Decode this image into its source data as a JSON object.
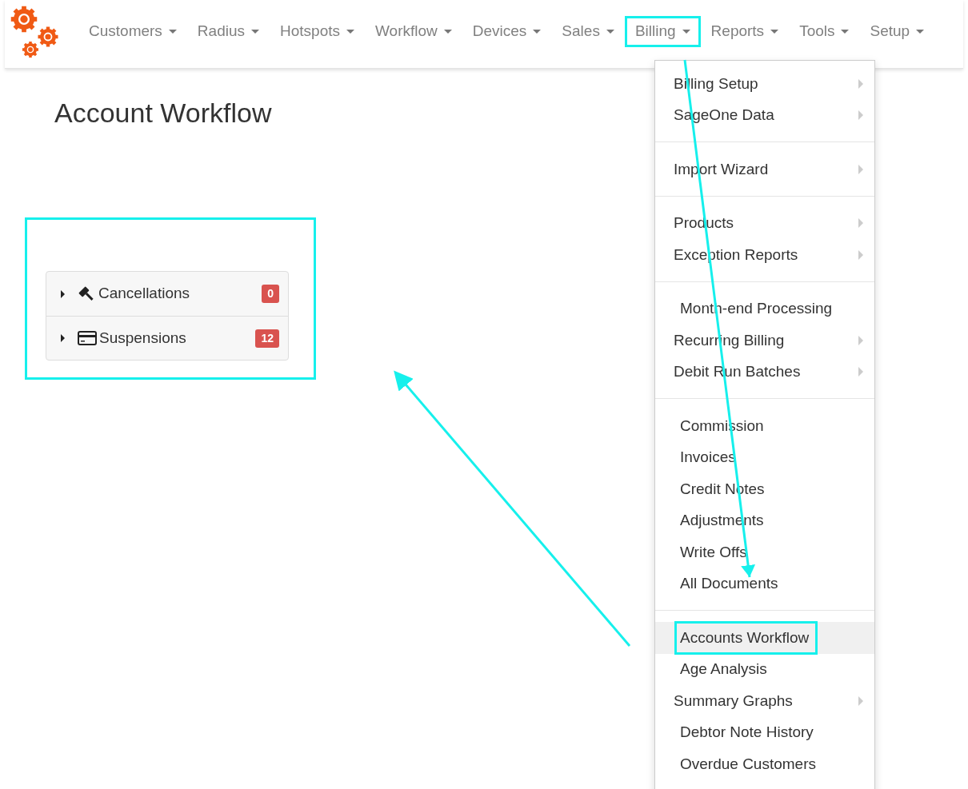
{
  "navbar": {
    "items": [
      {
        "label": "Customers",
        "selected": false
      },
      {
        "label": "Radius",
        "selected": false
      },
      {
        "label": "Hotspots",
        "selected": false
      },
      {
        "label": "Workflow",
        "selected": false
      },
      {
        "label": "Devices",
        "selected": false
      },
      {
        "label": "Sales",
        "selected": false
      },
      {
        "label": "Billing",
        "selected": true
      },
      {
        "label": "Reports",
        "selected": false
      },
      {
        "label": "Tools",
        "selected": false
      },
      {
        "label": "Setup",
        "selected": false
      }
    ]
  },
  "page": {
    "title": "Account Workflow"
  },
  "workflow_panel": {
    "rows": [
      {
        "label": "Cancellations",
        "kind": "gavel",
        "count": "0"
      },
      {
        "label": "Suspensions",
        "kind": "card",
        "count": "12"
      }
    ]
  },
  "billing_menu": {
    "groups": [
      [
        {
          "label": "Billing Setup",
          "submenu": true,
          "selected": false
        },
        {
          "label": "SageOne Data",
          "submenu": true,
          "selected": false
        }
      ],
      [
        {
          "label": "Import Wizard",
          "submenu": true,
          "selected": false
        }
      ],
      [
        {
          "label": "Products",
          "submenu": true,
          "selected": false
        },
        {
          "label": "Exception Reports",
          "submenu": true,
          "selected": false
        }
      ],
      [
        {
          "label": "Month-end Processing",
          "submenu": false,
          "selected": false
        },
        {
          "label": "Recurring Billing",
          "submenu": true,
          "selected": false
        },
        {
          "label": "Debit Run Batches",
          "submenu": true,
          "selected": false
        }
      ],
      [
        {
          "label": "Commission",
          "submenu": false,
          "selected": false
        },
        {
          "label": "Invoices",
          "submenu": false,
          "selected": false
        },
        {
          "label": "Credit Notes",
          "submenu": false,
          "selected": false
        },
        {
          "label": "Adjustments",
          "submenu": false,
          "selected": false
        },
        {
          "label": "Write Offs",
          "submenu": false,
          "selected": false
        },
        {
          "label": "All Documents",
          "submenu": false,
          "selected": false
        }
      ],
      [
        {
          "label": "Accounts Workflow",
          "submenu": false,
          "selected": true
        },
        {
          "label": "Age Analysis",
          "submenu": false,
          "selected": false
        },
        {
          "label": "Summary Graphs",
          "submenu": true,
          "selected": false
        },
        {
          "label": "Debtor Note History",
          "submenu": false,
          "selected": false
        },
        {
          "label": "Overdue Customers",
          "submenu": false,
          "selected": false
        }
      ]
    ]
  }
}
